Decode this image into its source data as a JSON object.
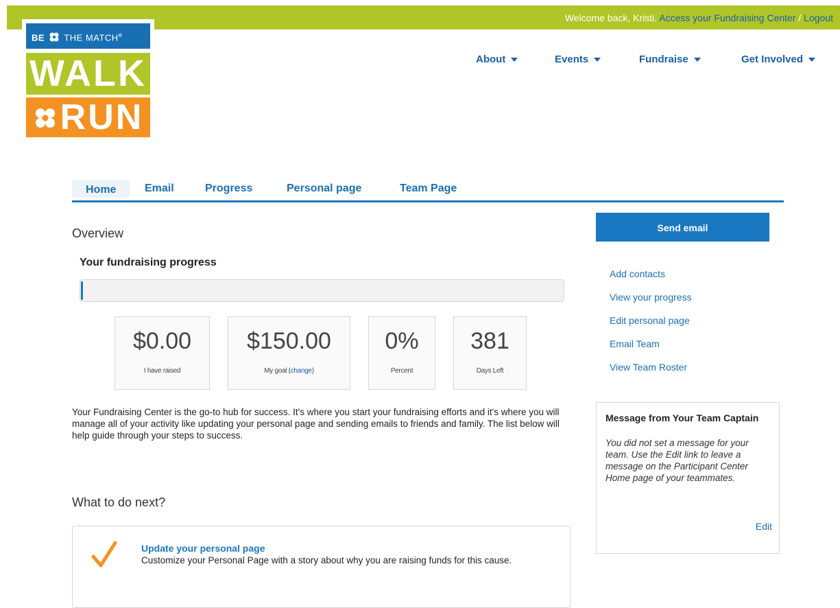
{
  "topbar": {
    "welcome": "Welcome back, Kristi.",
    "center_link": "Access your Fundraising Center",
    "separator": " / ",
    "logout": "Logout"
  },
  "logo": {
    "line1": "BE",
    "line1b": "THE MATCH",
    "mark": "®",
    "walk": "WALK",
    "run": "RUN"
  },
  "mainnav": [
    {
      "label": "About"
    },
    {
      "label": "Events"
    },
    {
      "label": "Fundraise"
    },
    {
      "label": "Get Involved"
    }
  ],
  "tabs": [
    {
      "label": "Home",
      "active": true
    },
    {
      "label": "Email"
    },
    {
      "label": "Progress"
    },
    {
      "label": "Personal page"
    },
    {
      "label": "Team Page"
    }
  ],
  "overview": {
    "heading": "Overview",
    "progress_heading": "Your fundraising progress",
    "progress_fraction": 0.0,
    "stats": [
      {
        "value": "$0.00",
        "label": "I have raised"
      },
      {
        "value": "$150.00",
        "label": "My goal (",
        "link": "change",
        "label_end": ")"
      },
      {
        "value": "0%",
        "label": "Percent"
      },
      {
        "value": "381",
        "label": "Days Left"
      }
    ],
    "intro": "Your Fundraising Center is the go-to hub for success. It's where you start your fundraising efforts and it's where you will manage all of your activity like updating your personal page and sending emails to friends and family. The list below will help guide through your steps to success."
  },
  "next": {
    "heading": "What to do next?",
    "item_title": "Update your personal page",
    "item_desc": "Customize your Personal Page with a story about why you are raising funds for this cause."
  },
  "sidebar": {
    "send_button": "Send email",
    "links": [
      "Add contacts",
      "View your progress",
      "Edit personal page",
      "Email Team",
      "View Team Roster"
    ],
    "message_title": "Message from Your Team Captain",
    "message_body": "You did not set a message for your team. Use the Edit link to leave a message on the Participant Center Home page of your teammates.",
    "edit": "Edit"
  },
  "colors": {
    "lime": "#b0c528",
    "blue": "#1a78c2",
    "orange": "#f39222"
  }
}
